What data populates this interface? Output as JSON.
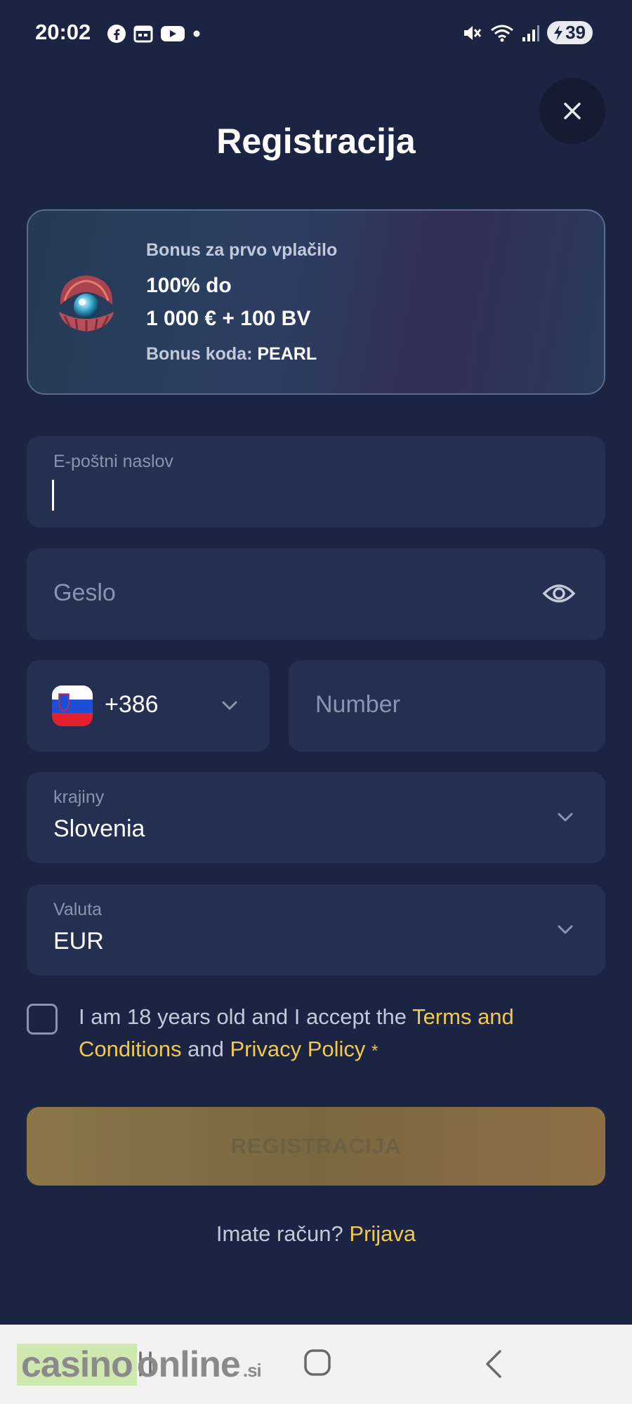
{
  "status_bar": {
    "time": "20:02",
    "icons_left": [
      "facebook-icon",
      "calendar-icon",
      "youtube-icon",
      "dot-icon"
    ],
    "icons_right": [
      "mute-icon",
      "wifi-icon",
      "signal-icon"
    ],
    "battery": "39"
  },
  "header": {
    "title": "Registracija",
    "close_icon": "close-icon"
  },
  "bonus": {
    "line1": "Bonus za prvo vplačilo",
    "line2": "100% do",
    "line3": "1 000 € + 100 BV",
    "code_label": "Bonus koda:",
    "code_value": "PEARL"
  },
  "form": {
    "email_label": "E-poštni naslov",
    "email_value": "",
    "password_placeholder": "Geslo",
    "phone_code": "+386",
    "phone_placeholder": "Number",
    "country_label": "krajiny",
    "country_value": "Slovenia",
    "currency_label": "Valuta",
    "currency_value": "EUR",
    "terms_prefix": "I am 18 years old and I accept the",
    "terms_link": "Terms and Conditions",
    "terms_and": "and",
    "privacy_link": "Privacy Policy",
    "required_mark": "*",
    "submit_label": "REGISTRACIJA",
    "login_prompt": "Imate račun?",
    "login_link": "Prijava"
  },
  "colors": {
    "background": "#1b2442",
    "field": "#252f51",
    "accent": "#f2c94c"
  },
  "watermark": {
    "part1": "casino",
    "part2": "online",
    "suffix": ".si"
  }
}
